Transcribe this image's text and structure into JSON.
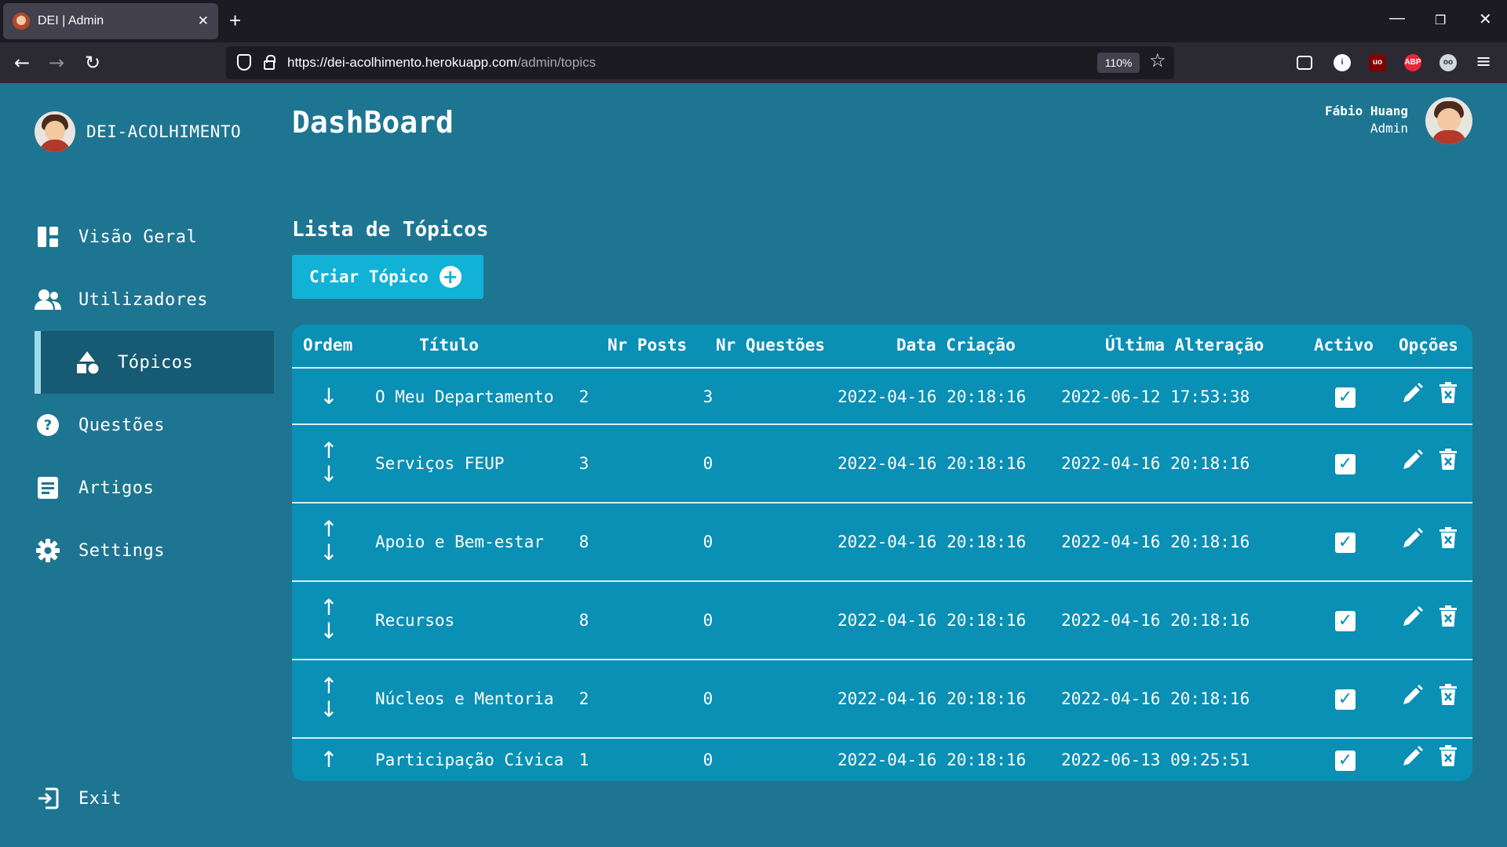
{
  "browser": {
    "tab_title": "DEI | Admin",
    "url_host": "https://dei-acolhimento.herokuapp.com",
    "url_path": "/admin/topics",
    "zoom": "110%"
  },
  "brand": {
    "name": "DEI-ACOLHIMENTO"
  },
  "user": {
    "name": "Fábio Huang",
    "role": "Admin"
  },
  "page_title": "DashBoard",
  "sidebar": {
    "items": [
      {
        "label": "Visão Geral",
        "icon": "dashboard-icon"
      },
      {
        "label": "Utilizadores",
        "icon": "users-icon"
      },
      {
        "label": "Tópicos",
        "icon": "shapes-icon",
        "active": true
      },
      {
        "label": "Questões",
        "icon": "question-icon"
      },
      {
        "label": "Artigos",
        "icon": "article-icon"
      },
      {
        "label": "Settings",
        "icon": "gear-icon"
      }
    ],
    "exit_label": "Exit"
  },
  "topics": {
    "title": "Lista de Tópicos",
    "create_label": "Criar Tópico",
    "columns": [
      "Ordem",
      "Título",
      "Nr Posts",
      "Nr Questões",
      "Data Criação",
      "Última Alteração",
      "Activo",
      "Opções"
    ],
    "rows": [
      {
        "title": "O Meu Departamento",
        "posts": "2",
        "questions": "3",
        "created": "2022-04-16 20:18:16",
        "updated": "2022-06-12 17:53:38",
        "active": true,
        "up": false,
        "down": true
      },
      {
        "title": "Serviços FEUP",
        "posts": "3",
        "questions": "0",
        "created": "2022-04-16 20:18:16",
        "updated": "2022-04-16 20:18:16",
        "active": true,
        "up": true,
        "down": true
      },
      {
        "title": "Apoio e Bem-estar",
        "posts": "8",
        "questions": "0",
        "created": "2022-04-16 20:18:16",
        "updated": "2022-04-16 20:18:16",
        "active": true,
        "up": true,
        "down": true
      },
      {
        "title": "Recursos",
        "posts": "8",
        "questions": "0",
        "created": "2022-04-16 20:18:16",
        "updated": "2022-04-16 20:18:16",
        "active": true,
        "up": true,
        "down": true
      },
      {
        "title": "Núcleos e Mentoria",
        "posts": "2",
        "questions": "0",
        "created": "2022-04-16 20:18:16",
        "updated": "2022-04-16 20:18:16",
        "active": true,
        "up": true,
        "down": true
      },
      {
        "title": "Participação Cívica",
        "posts": "1",
        "questions": "0",
        "created": "2022-04-16 20:18:16",
        "updated": "2022-06-13 09:25:51",
        "active": true,
        "up": true,
        "down": false
      }
    ]
  },
  "colors": {
    "page_bg": "#1e7592",
    "table_bg": "#0a8fb5",
    "button_bg": "#11b2d6",
    "active_nav_bg": "#175a73"
  }
}
